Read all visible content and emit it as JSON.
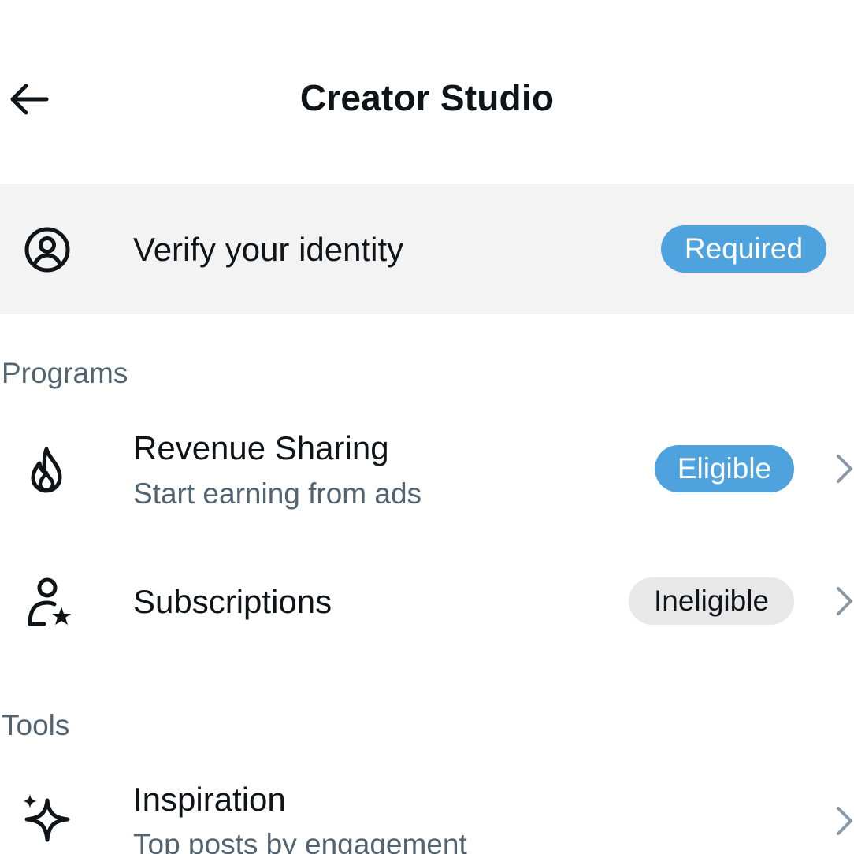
{
  "header": {
    "title": "Creator Studio",
    "back_icon": "arrow-left-icon"
  },
  "verify": {
    "icon": "user-circle-icon",
    "label": "Verify your identity",
    "badge": "Required",
    "badge_color": "#4ea3df"
  },
  "programs": {
    "heading": "Programs",
    "items": [
      {
        "icon": "flame-icon",
        "title": "Revenue Sharing",
        "subtitle": "Start earning from ads",
        "badge": "Eligible",
        "badge_color": "#4ea3df"
      },
      {
        "icon": "person-star-icon",
        "title": "Subscriptions",
        "badge": "Ineligible",
        "badge_color": "#e8e8e8"
      }
    ]
  },
  "tools": {
    "heading": "Tools",
    "items": [
      {
        "icon": "sparkle-icon",
        "title": "Inspiration",
        "subtitle": "Top posts by engagement"
      }
    ]
  },
  "colors": {
    "text_primary": "#0f1419",
    "text_secondary": "#536471",
    "card_bg": "#f3f3f3"
  }
}
